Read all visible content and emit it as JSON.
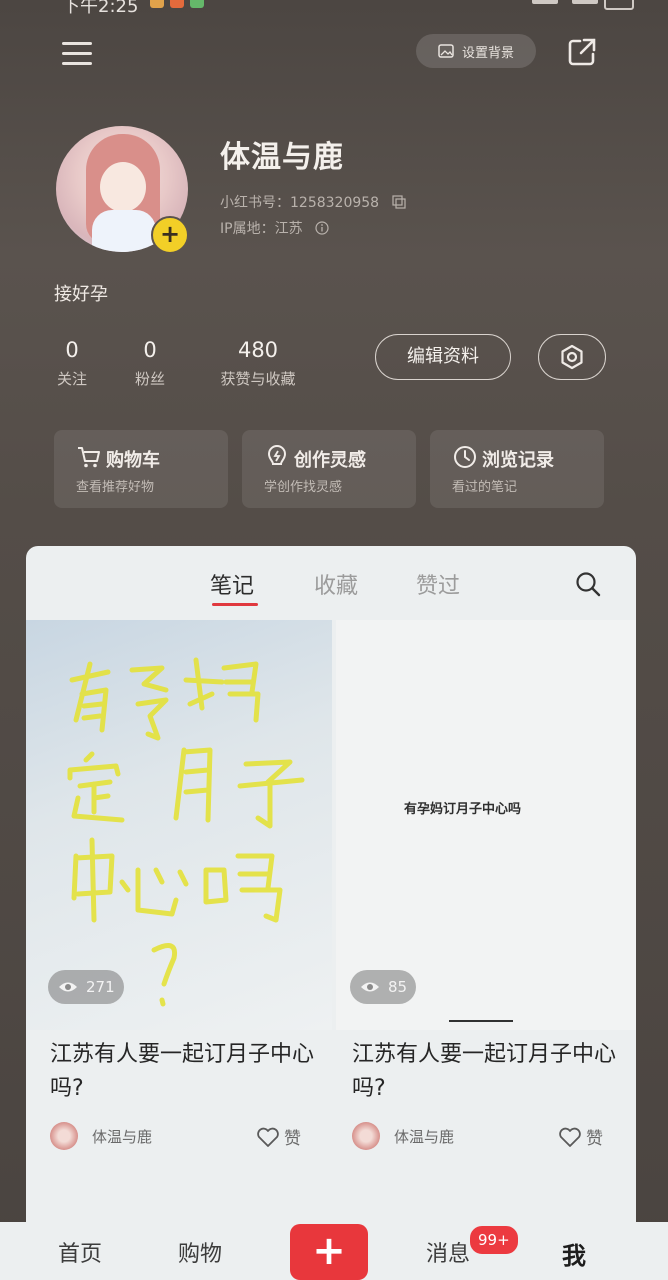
{
  "status": {
    "time": "下午2:25"
  },
  "header": {
    "bg_button": "设置背景"
  },
  "profile": {
    "name": "体温与鹿",
    "id_text": "小红书号：1258320958",
    "ip_text": "IP属地：江苏",
    "bio": "接好孕",
    "stats": [
      {
        "num": "0",
        "label": "关注"
      },
      {
        "num": "0",
        "label": "粉丝"
      },
      {
        "num": "480",
        "label": "获赞与收藏"
      }
    ],
    "edit_button": "编辑资料"
  },
  "cards": [
    {
      "title": "购物车",
      "sub": "查看推荐好物",
      "icon": "cart-icon"
    },
    {
      "title": "创作灵感",
      "sub": "学创作找灵感",
      "icon": "bulb-icon"
    },
    {
      "title": "浏览记录",
      "sub": "看过的笔记",
      "icon": "clock-icon"
    }
  ],
  "tabs": [
    "笔记",
    "收藏",
    "赞过"
  ],
  "notes": [
    {
      "views": "271",
      "title": "江苏有人要一起订月子中心吗?",
      "author": "体温与鹿",
      "like": "赞"
    },
    {
      "views": "85",
      "title": "江苏有人要一起订月子中心吗?",
      "author": "体温与鹿",
      "like": "赞",
      "image_text": "有孕妈订月子中心吗"
    }
  ],
  "nav": {
    "home": "首页",
    "shop": "购物",
    "plus": "+",
    "msg": "消息",
    "badge": "99+",
    "me": "我"
  },
  "colors": {
    "accent": "#e8373c",
    "handwriting": "#e4e23a"
  }
}
